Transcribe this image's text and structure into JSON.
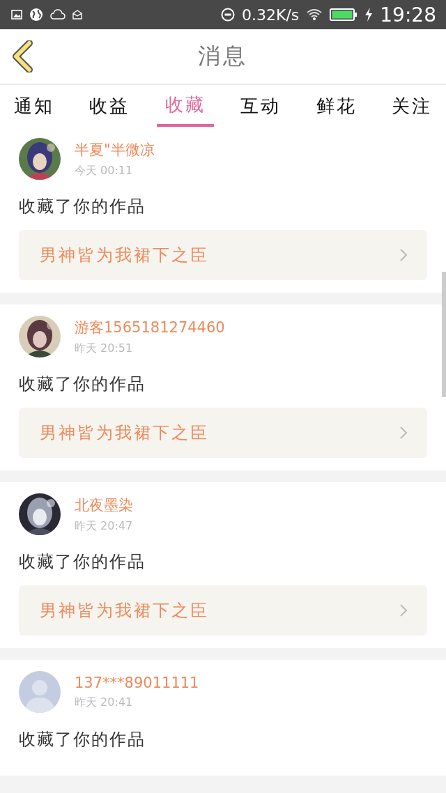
{
  "status_bar": {
    "speed": "0.32K/s",
    "time": "19:28"
  },
  "header": {
    "title": "消息"
  },
  "tabs": [
    {
      "label": "通知",
      "selected": false
    },
    {
      "label": "收益",
      "selected": false
    },
    {
      "label": "收藏",
      "selected": true
    },
    {
      "label": "互动",
      "selected": false
    },
    {
      "label": "鲜花",
      "selected": false
    },
    {
      "label": "关注",
      "selected": false
    }
  ],
  "messages": [
    {
      "name": "半夏\"半微凉",
      "time": "今天 00:11",
      "text": "收藏了你的作品",
      "work": "男神皆为我裙下之臣"
    },
    {
      "name": "游客1565181274460",
      "time": "昨天 20:51",
      "text": "收藏了你的作品",
      "work": "男神皆为我裙下之臣"
    },
    {
      "name": "北夜墨染",
      "time": "昨天 20:47",
      "text": "收藏了你的作品",
      "work": "男神皆为我裙下之臣"
    },
    {
      "avatar": {
        "kind": "default"
      },
      "name": "137***89011111",
      "time": "昨天 20:41",
      "text": "收藏了你的作品"
    }
  ]
}
